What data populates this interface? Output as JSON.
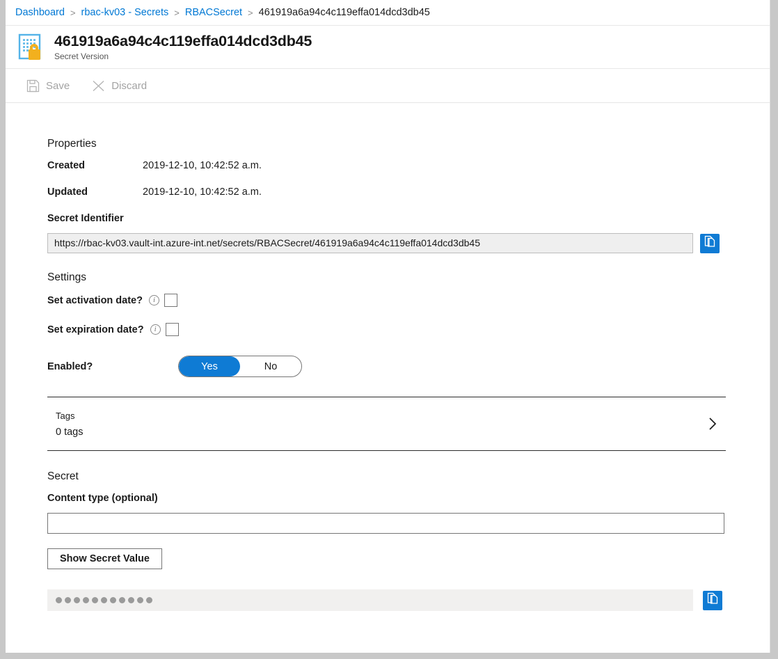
{
  "breadcrumb": {
    "items": [
      {
        "label": "Dashboard",
        "link": true
      },
      {
        "label": "rbac-kv03 - Secrets",
        "link": true
      },
      {
        "label": "RBACSecret",
        "link": true
      },
      {
        "label": "461919a6a94c4c119effa014dcd3db45",
        "link": false
      }
    ],
    "separator": ">"
  },
  "header": {
    "title": "461919a6a94c4c119effa014dcd3db45",
    "subtitle": "Secret Version",
    "icon": "secret-version-icon"
  },
  "toolbar": {
    "save_label": "Save",
    "save_icon": "save-floppy-icon",
    "discard_label": "Discard",
    "discard_icon": "close-x-icon",
    "disabled": true
  },
  "properties": {
    "heading": "Properties",
    "rows": [
      {
        "key": "Created",
        "value": "2019-12-10, 10:42:52 a.m."
      },
      {
        "key": "Updated",
        "value": "2019-12-10, 10:42:52 a.m."
      }
    ]
  },
  "identifier": {
    "label": "Secret Identifier",
    "value": "https://rbac-kv03.vault-int.azure-int.net/secrets/RBACSecret/461919a6a94c4c119effa014dcd3db45",
    "copy_icon": "copy-icon"
  },
  "settings": {
    "heading": "Settings",
    "activation": {
      "label": "Set activation date?",
      "checked": false,
      "info_icon": "info-icon",
      "info_glyph": "i"
    },
    "expiration": {
      "label": "Set expiration date?",
      "checked": false,
      "info_icon": "info-icon",
      "info_glyph": "i"
    },
    "enabled": {
      "label": "Enabled?",
      "yes_label": "Yes",
      "no_label": "No",
      "selected": "Yes"
    }
  },
  "tags": {
    "title": "Tags",
    "count_label": "0 tags",
    "chevron_icon": "chevron-right-icon"
  },
  "secret": {
    "heading": "Secret",
    "content_type_label": "Content type (optional)",
    "content_type_value": "",
    "content_type_placeholder": "",
    "show_button_label": "Show Secret Value",
    "masked_value_dots": 11,
    "copy_icon": "copy-icon"
  },
  "colors": {
    "accent": "#0078d4",
    "copy_button": "#0f7bd4",
    "toggle_on": "#0f7bd4",
    "disabled_text": "#a3a3a3",
    "page_bg": "#ffffff",
    "chrome_bg": "#c8c8c8",
    "readonly_field": "#efefef",
    "masked_field": "#f1f0ef",
    "icon_page": "#54b3e8",
    "icon_lock": "#f2b01e"
  }
}
